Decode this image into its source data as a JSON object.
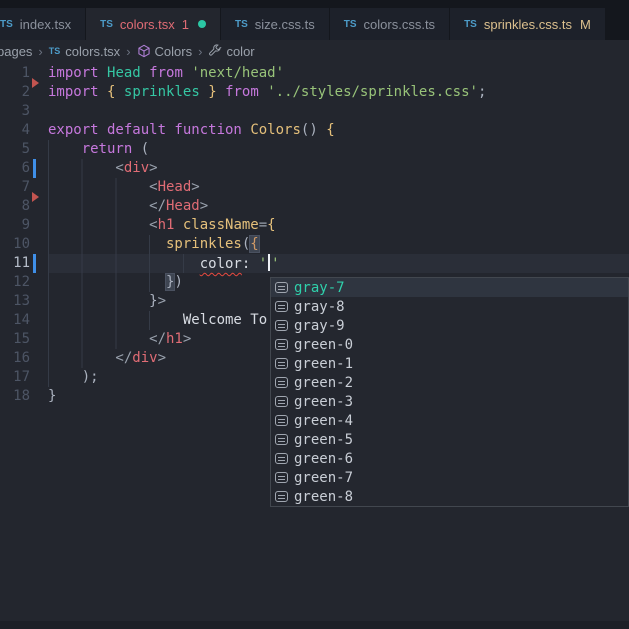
{
  "tabs": [
    {
      "id": "index",
      "icon": "TS",
      "label": "index.tsx",
      "state": "inactive"
    },
    {
      "id": "colors",
      "icon": "TS",
      "label": "colors.tsx",
      "state": "active",
      "error_count": "1",
      "modified_dot": true
    },
    {
      "id": "size",
      "icon": "TS",
      "label": "size.css.ts",
      "state": "inactive"
    },
    {
      "id": "colors-css",
      "icon": "TS",
      "label": "colors.css.ts",
      "state": "inactive"
    },
    {
      "id": "sprinkles",
      "icon": "TS",
      "label": "sprinkles.css.ts",
      "state": "inactive",
      "git_status": "M",
      "git_modified": true
    }
  ],
  "breadcrumbs": [
    {
      "label": "pages",
      "icon": ""
    },
    {
      "label": "colors.tsx",
      "icon": "ts"
    },
    {
      "label": "Colors",
      "icon": "cube"
    },
    {
      "label": "color",
      "icon": "wrench"
    }
  ],
  "editor": {
    "lines": [
      {
        "num": 1,
        "indent": 0,
        "git_deleted_below": true,
        "tokens": [
          {
            "t": "import",
            "c": "kw"
          },
          {
            "t": " ",
            "c": "plain"
          },
          {
            "t": "Head",
            "c": "teal"
          },
          {
            "t": " ",
            "c": "plain"
          },
          {
            "t": "from",
            "c": "kw"
          },
          {
            "t": " ",
            "c": "plain"
          },
          {
            "t": "'next/head'",
            "c": "str"
          }
        ]
      },
      {
        "num": 2,
        "indent": 0,
        "tokens": [
          {
            "t": "import",
            "c": "kw"
          },
          {
            "t": " ",
            "c": "plain"
          },
          {
            "t": "{",
            "c": "yellow"
          },
          {
            "t": " ",
            "c": "plain"
          },
          {
            "t": "sprinkles",
            "c": "teal"
          },
          {
            "t": " ",
            "c": "plain"
          },
          {
            "t": "}",
            "c": "yellow"
          },
          {
            "t": " ",
            "c": "plain"
          },
          {
            "t": "from",
            "c": "kw"
          },
          {
            "t": " ",
            "c": "plain"
          },
          {
            "t": "'../styles/sprinkles.css'",
            "c": "str"
          },
          {
            "t": ";",
            "c": "plain"
          }
        ]
      },
      {
        "num": 3,
        "indent": 0,
        "tokens": []
      },
      {
        "num": 4,
        "indent": 0,
        "tokens": [
          {
            "t": "export default function",
            "c": "kw"
          },
          {
            "t": " ",
            "c": "plain"
          },
          {
            "t": "Colors",
            "c": "fn"
          },
          {
            "t": "()",
            "c": "plain"
          },
          {
            "t": " ",
            "c": "plain"
          },
          {
            "t": "{",
            "c": "yellow"
          }
        ]
      },
      {
        "num": 5,
        "indent": 4,
        "tokens": [
          {
            "t": "return",
            "c": "kw"
          },
          {
            "t": " (",
            "c": "plain"
          }
        ]
      },
      {
        "num": 6,
        "indent": 8,
        "git": "modified",
        "tokens": [
          {
            "t": "<",
            "c": "punct"
          },
          {
            "t": "div",
            "c": "tag"
          },
          {
            "t": ">",
            "c": "punct"
          }
        ]
      },
      {
        "num": 7,
        "indent": 12,
        "git_deleted_below": true,
        "tokens": [
          {
            "t": "<",
            "c": "punct"
          },
          {
            "t": "Head",
            "c": "tag"
          },
          {
            "t": ">",
            "c": "punct"
          }
        ]
      },
      {
        "num": 8,
        "indent": 12,
        "tokens": [
          {
            "t": "</",
            "c": "punct"
          },
          {
            "t": "Head",
            "c": "tag"
          },
          {
            "t": ">",
            "c": "punct"
          }
        ]
      },
      {
        "num": 9,
        "indent": 12,
        "tokens": [
          {
            "t": "<",
            "c": "punct"
          },
          {
            "t": "h1",
            "c": "tag"
          },
          {
            "t": " ",
            "c": "plain"
          },
          {
            "t": "className",
            "c": "attr"
          },
          {
            "t": "=",
            "c": "punct"
          },
          {
            "t": "{",
            "c": "yellow"
          }
        ]
      },
      {
        "num": 10,
        "indent": 14,
        "tokens": [
          {
            "t": "sprinkles",
            "c": "fn"
          },
          {
            "t": "(",
            "c": "plain"
          },
          {
            "t": "{",
            "c": "orange",
            "match": true
          }
        ]
      },
      {
        "num": 11,
        "indent": 18,
        "current": true,
        "git": "modified",
        "tokens": [
          {
            "t": "color",
            "c": "white",
            "err": true
          },
          {
            "t": ":",
            "c": "white"
          },
          {
            "t": " ",
            "c": "plain"
          },
          {
            "t": "'",
            "c": "str"
          },
          {
            "t": "",
            "c": "cursor"
          },
          {
            "t": "'",
            "c": "str"
          }
        ]
      },
      {
        "num": 12,
        "indent": 14,
        "tokens": [
          {
            "t": "}",
            "c": "plain",
            "match": true
          },
          {
            "t": ")",
            "c": "plain"
          }
        ]
      },
      {
        "num": 13,
        "indent": 12,
        "tokens": [
          {
            "t": "}",
            "c": "plain"
          },
          {
            "t": ">",
            "c": "punct"
          }
        ]
      },
      {
        "num": 14,
        "indent": 16,
        "tokens": [
          {
            "t": "Welcome To",
            "c": "white"
          }
        ]
      },
      {
        "num": 15,
        "indent": 12,
        "tokens": [
          {
            "t": "</",
            "c": "punct"
          },
          {
            "t": "h1",
            "c": "tag"
          },
          {
            "t": ">",
            "c": "punct"
          }
        ]
      },
      {
        "num": 16,
        "indent": 8,
        "tokens": [
          {
            "t": "</",
            "c": "punct"
          },
          {
            "t": "div",
            "c": "tag"
          },
          {
            "t": ">",
            "c": "punct"
          }
        ]
      },
      {
        "num": 17,
        "indent": 4,
        "tokens": [
          {
            "t": ");",
            "c": "plain"
          }
        ]
      },
      {
        "num": 18,
        "indent": 0,
        "tokens": [
          {
            "t": "}",
            "c": "plain"
          }
        ]
      }
    ]
  },
  "suggest": {
    "items": [
      {
        "label": "gray-7",
        "selected": true
      },
      {
        "label": "gray-8"
      },
      {
        "label": "gray-9"
      },
      {
        "label": "green-0"
      },
      {
        "label": "green-1"
      },
      {
        "label": "green-2"
      },
      {
        "label": "green-3"
      },
      {
        "label": "green-4"
      },
      {
        "label": "green-5"
      },
      {
        "label": "green-6"
      },
      {
        "label": "green-7"
      },
      {
        "label": "green-8"
      }
    ]
  },
  "colors": {
    "editor_bg": "#23262e",
    "tabbar_bg": "#14171d",
    "tab_inactive_bg": "#1d212a",
    "tab_error_text": "#e06c75",
    "tab_git_modified_text": "#dcc08e",
    "ts_icon": "#4d9cc9",
    "modified_dot": "#2bc7a4",
    "git_modified_bar": "#3f8fe8",
    "git_deleted_arrow": "#c25450",
    "keyword": "#c678dd",
    "string": "#98c379",
    "import_name": "#35c7a4",
    "function_name": "#e5c07b",
    "jsx_tag": "#e06c75",
    "error_squiggle": "#e8493f",
    "suggest_selected_text": "#2fd0ab"
  }
}
